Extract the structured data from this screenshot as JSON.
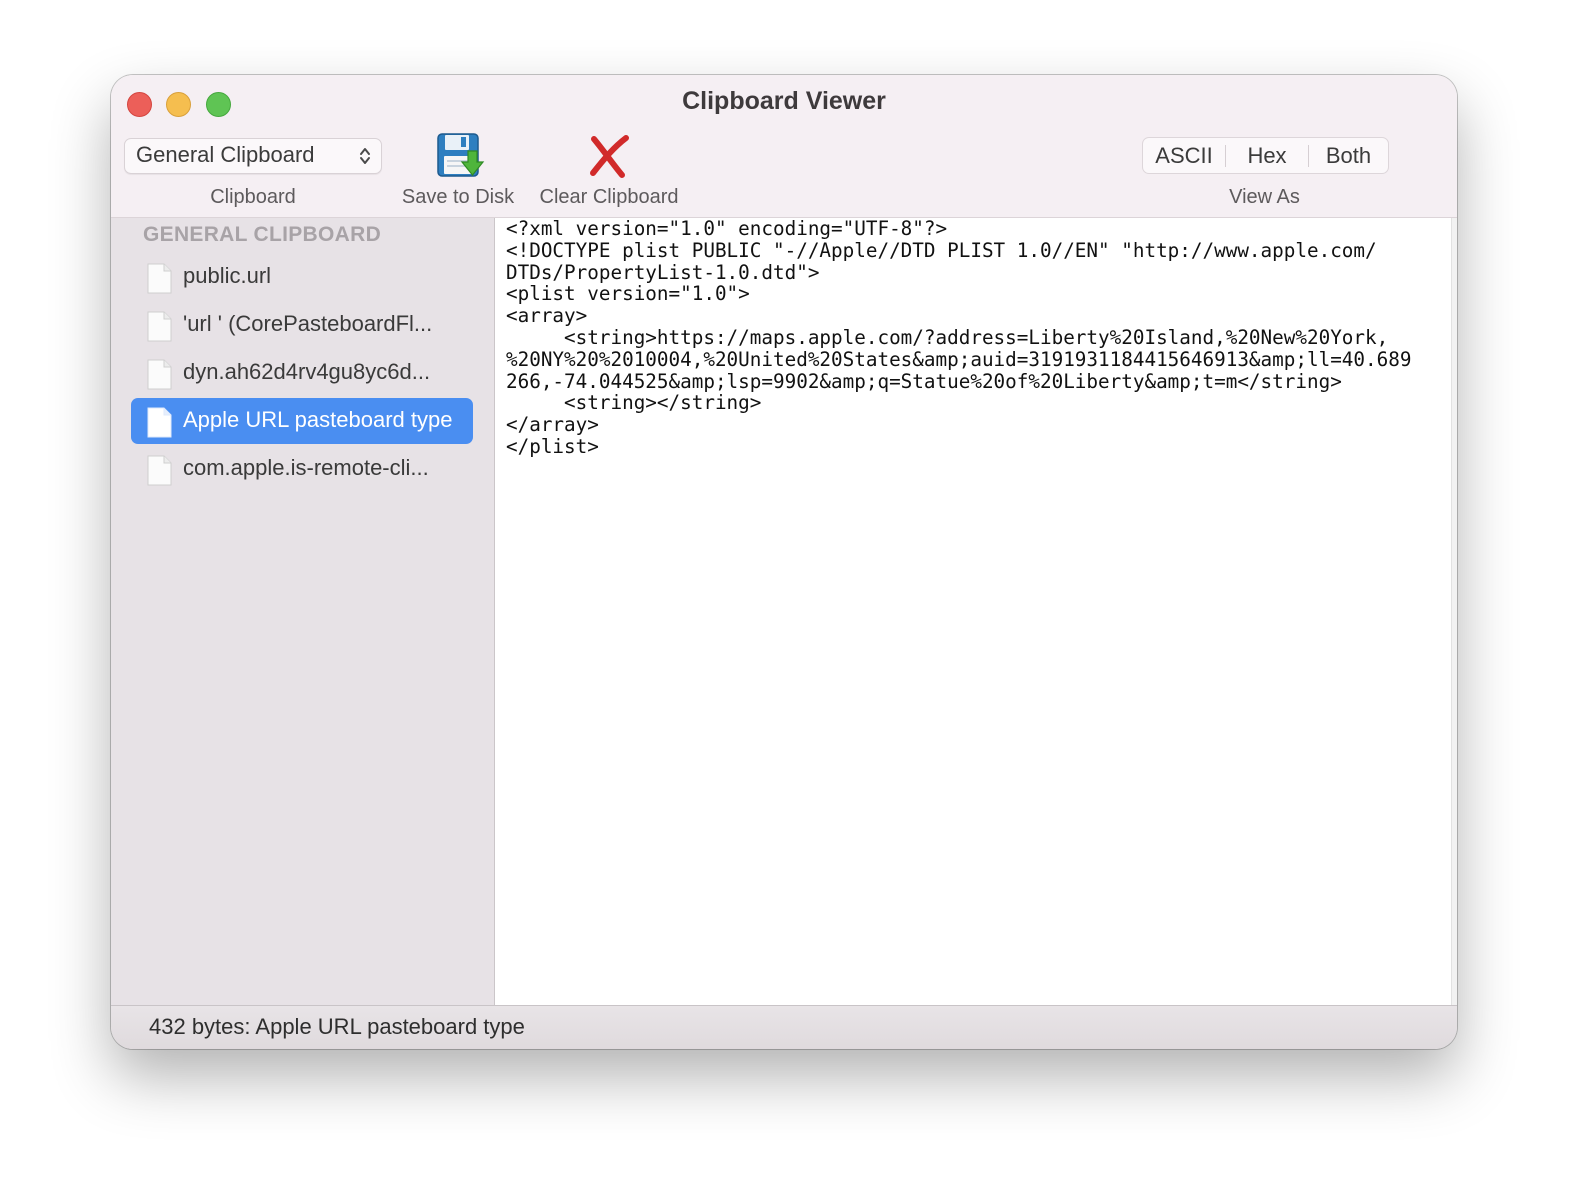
{
  "window": {
    "title": "Clipboard Viewer"
  },
  "toolbar": {
    "clipboard_popup": {
      "selected": "General Clipboard",
      "caption": "Clipboard"
    },
    "save_button": {
      "label": "Save to Disk",
      "icon": "floppy-disk-icon"
    },
    "clear_button": {
      "label": "Clear Clipboard",
      "icon": "red-x-icon"
    },
    "view_as": {
      "caption": "View As",
      "options": [
        "ASCII",
        "Hex",
        "Both"
      ],
      "selected": "ASCII"
    }
  },
  "sidebar": {
    "header": "GENERAL CLIPBOARD",
    "items": [
      {
        "label": "public.url"
      },
      {
        "label": "'url ' (CorePasteboardFl..."
      },
      {
        "label": "dyn.ah62d4rv4gu8yc6d..."
      },
      {
        "label": "Apple URL pasteboard type"
      },
      {
        "label": "com.apple.is-remote-cli..."
      }
    ],
    "selected_index": 3
  },
  "content": {
    "text": "<?xml version=\"1.0\" encoding=\"UTF-8\"?>\n<!DOCTYPE plist PUBLIC \"-//Apple//DTD PLIST 1.0//EN\" \"http://www.apple.com/\nDTDs/PropertyList-1.0.dtd\">\n<plist version=\"1.0\">\n<array>\n     <string>https://maps.apple.com/?address=Liberty%20Island,%20New%20York,\n%20NY%20%2010004,%20United%20States&amp;auid=3191931184415646913&amp;ll=40.689\n266,-74.044525&amp;lsp=9902&amp;q=Statue%20of%20Liberty&amp;t=m</string>\n     <string></string>\n</array>\n</plist>"
  },
  "status": {
    "text": "432 bytes: Apple URL pasteboard type"
  },
  "colors": {
    "toolbar_bg": "#f5eff3",
    "sidebar_bg": "#e7e2e6",
    "selection": "#4a8ef1",
    "close": "#ec5f59",
    "minimize": "#f5be4f",
    "maximize": "#5fc454"
  }
}
